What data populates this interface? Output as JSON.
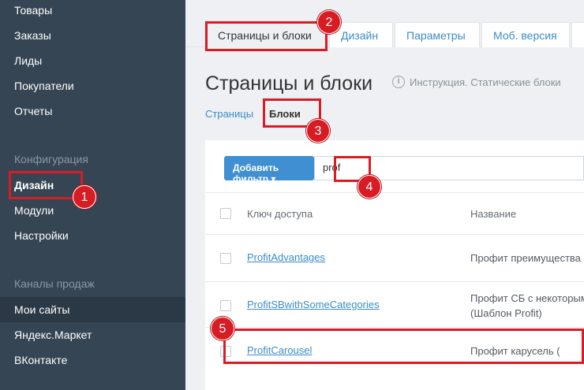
{
  "sidebar": {
    "items_top": [
      "Товары",
      "Заказы",
      "Лиды",
      "Покупатели",
      "Отчеты"
    ],
    "section_config": "Конфигурация",
    "items_config": [
      "Дизайн",
      "Модули",
      "Настройки"
    ],
    "section_channels": "Каналы продаж",
    "items_channels": [
      "Мои сайты",
      "Яндекс.Маркет",
      "ВКонтакте"
    ]
  },
  "tabs": [
    "Страницы и блоки",
    "Дизайн",
    "Параметры",
    "Моб. версия"
  ],
  "page": {
    "title": "Страницы и блоки",
    "help_icon": "i",
    "help_text": "Инструкция. Статические блоки",
    "sub_pages": "Страницы",
    "sub_blocks": "Блоки"
  },
  "filter": {
    "add_button": "Добавить фильтр ▾",
    "input_value": "prof"
  },
  "table": {
    "col_key": "Ключ доступа",
    "col_name": "Название",
    "rows": [
      {
        "key": "ProfitAdvantages",
        "name_line1": "Профит преимущества",
        "name_line2": ""
      },
      {
        "key": "ProfitSBwithSomeCategories",
        "name_line1": "Профит СБ с некоторыми",
        "name_line2": "(Шаблон Profit)"
      },
      {
        "key": "ProfitCarousel",
        "name_line1": "Профит карусель (",
        "name_line2": ""
      }
    ]
  },
  "annotations": [
    "1",
    "2",
    "3",
    "4",
    "5"
  ],
  "colors": {
    "annotation": "#d81c24",
    "sidebar": "#354553",
    "link": "#3a8cc8",
    "button": "#3f8fd2"
  }
}
